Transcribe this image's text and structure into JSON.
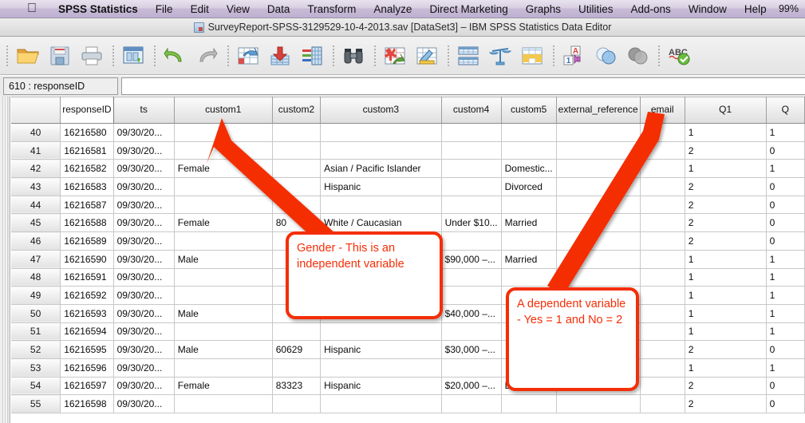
{
  "menubar": {
    "apple_icon": "apple-logo-icon",
    "items": [
      {
        "label": "SPSS Statistics",
        "bold": true
      },
      {
        "label": "File"
      },
      {
        "label": "Edit"
      },
      {
        "label": "View"
      },
      {
        "label": "Data"
      },
      {
        "label": "Transform"
      },
      {
        "label": "Analyze"
      },
      {
        "label": "Direct Marketing"
      },
      {
        "label": "Graphs"
      },
      {
        "label": "Utilities"
      },
      {
        "label": "Add-ons"
      },
      {
        "label": "Window"
      },
      {
        "label": "Help"
      }
    ],
    "battery_percent": "99%"
  },
  "titlebar": {
    "document_icon": "spss-document-icon",
    "title": "SurveyReport-SPSS-3129529-10-4-2013.sav [DataSet3] – IBM SPSS Statistics Data Editor"
  },
  "toolbar": {
    "buttons": [
      {
        "name": "open-file-icon",
        "glyph": "folder"
      },
      {
        "name": "save-file-icon",
        "glyph": "floppy"
      },
      {
        "name": "print-icon",
        "glyph": "printer"
      },
      {
        "name": "recall-dialogs-icon",
        "glyph": "window"
      },
      {
        "name": "undo-icon",
        "glyph": "undo"
      },
      {
        "name": "redo-icon",
        "glyph": "redo"
      },
      {
        "name": "goto-case-icon",
        "glyph": "goto-case"
      },
      {
        "name": "goto-variable-icon",
        "glyph": "goto-variable"
      },
      {
        "name": "variables-icon",
        "glyph": "variables"
      },
      {
        "name": "find-icon",
        "glyph": "binoculars"
      },
      {
        "name": "insert-case-icon",
        "glyph": "insert-case"
      },
      {
        "name": "insert-variable-icon",
        "glyph": "insert-variable"
      },
      {
        "name": "split-file-icon",
        "glyph": "split-file"
      },
      {
        "name": "weight-cases-icon",
        "glyph": "scales"
      },
      {
        "name": "select-cases-icon",
        "glyph": "select-cases"
      },
      {
        "name": "value-labels-icon",
        "glyph": "value-labels"
      },
      {
        "name": "use-variable-sets-icon",
        "glyph": "venn-blue"
      },
      {
        "name": "show-all-variables-icon",
        "glyph": "venn-gray"
      },
      {
        "name": "spell-check-icon",
        "glyph": "abc-check"
      }
    ]
  },
  "cell_reference": {
    "cell": "610 : responseID",
    "value": ""
  },
  "grid": {
    "columns": [
      {
        "key": "rownum",
        "label": "",
        "class": "c-rownum",
        "active": false
      },
      {
        "key": "responseID",
        "label": "responseID",
        "class": "c-responseID",
        "active": true
      },
      {
        "key": "ts",
        "label": "ts",
        "class": "c-ts",
        "active": false
      },
      {
        "key": "custom1",
        "label": "custom1",
        "class": "c-custom1",
        "active": false
      },
      {
        "key": "custom2",
        "label": "custom2",
        "class": "c-custom2",
        "active": false
      },
      {
        "key": "custom3",
        "label": "custom3",
        "class": "c-custom3",
        "active": false
      },
      {
        "key": "custom4",
        "label": "custom4",
        "class": "c-custom4",
        "active": false
      },
      {
        "key": "custom5",
        "label": "custom5",
        "class": "c-custom5",
        "active": false
      },
      {
        "key": "external",
        "label": "external_reference",
        "class": "c-external",
        "active": false
      },
      {
        "key": "email",
        "label": "email",
        "class": "c-email",
        "active": false
      },
      {
        "key": "Q1",
        "label": "Q1",
        "class": "c-Q1",
        "active": false
      },
      {
        "key": "Q2",
        "label": "Q",
        "class": "c-Q2",
        "active": false
      }
    ],
    "rows": [
      {
        "rownum": "40",
        "responseID": "16216580",
        "ts": "09/30/20...",
        "custom1": "",
        "custom2": "",
        "custom3": "",
        "custom4": "",
        "custom5": "",
        "external": "",
        "email": "",
        "Q1": "1",
        "Q2": "1"
      },
      {
        "rownum": "41",
        "responseID": "16216581",
        "ts": "09/30/20...",
        "custom1": "",
        "custom2": "",
        "custom3": "",
        "custom4": "",
        "custom5": "",
        "external": "",
        "email": "",
        "Q1": "2",
        "Q2": "0"
      },
      {
        "rownum": "42",
        "responseID": "16216582",
        "ts": "09/30/20...",
        "custom1": "Female",
        "custom2": "",
        "custom3": "Asian / Pacific Islander",
        "custom4": "",
        "custom5": "Domestic...",
        "external": "",
        "email": "",
        "Q1": "1",
        "Q2": "1"
      },
      {
        "rownum": "43",
        "responseID": "16216583",
        "ts": "09/30/20...",
        "custom1": "",
        "custom2": "",
        "custom3": "Hispanic",
        "custom4": "",
        "custom5": "Divorced",
        "external": "",
        "email": "",
        "Q1": "2",
        "Q2": "0"
      },
      {
        "rownum": "44",
        "responseID": "16216587",
        "ts": "09/30/20...",
        "custom1": "",
        "custom2": "",
        "custom3": "",
        "custom4": "",
        "custom5": "",
        "external": "",
        "email": "",
        "Q1": "2",
        "Q2": "0"
      },
      {
        "rownum": "45",
        "responseID": "16216588",
        "ts": "09/30/20...",
        "custom1": "Female",
        "custom2": "80",
        "custom3": "White / Caucasian",
        "custom4": "Under $10...",
        "custom5": "Married",
        "external": "",
        "email": "",
        "Q1": "2",
        "Q2": "0"
      },
      {
        "rownum": "46",
        "responseID": "16216589",
        "ts": "09/30/20...",
        "custom1": "",
        "custom2": "",
        "custom3": "",
        "custom4": "",
        "custom5": "",
        "external": "",
        "email": "",
        "Q1": "2",
        "Q2": "0"
      },
      {
        "rownum": "47",
        "responseID": "16216590",
        "ts": "09/30/20...",
        "custom1": "Male",
        "custom2": "",
        "custom3": "",
        "custom4": "$90,000 –...",
        "custom5": "Married",
        "external": "",
        "email": "",
        "Q1": "1",
        "Q2": "1"
      },
      {
        "rownum": "48",
        "responseID": "16216591",
        "ts": "09/30/20...",
        "custom1": "",
        "custom2": "",
        "custom3": "",
        "custom4": "",
        "custom5": "",
        "external": "",
        "email": "",
        "Q1": "1",
        "Q2": "1"
      },
      {
        "rownum": "49",
        "responseID": "16216592",
        "ts": "09/30/20...",
        "custom1": "",
        "custom2": "",
        "custom3": "",
        "custom4": "",
        "custom5": "",
        "external": "",
        "email": "",
        "Q1": "1",
        "Q2": "1"
      },
      {
        "rownum": "50",
        "responseID": "16216593",
        "ts": "09/30/20...",
        "custom1": "Male",
        "custom2": "",
        "custom3": "",
        "custom4": "$40,000 –...",
        "custom5": "",
        "external": "",
        "email": "",
        "Q1": "1",
        "Q2": "1"
      },
      {
        "rownum": "51",
        "responseID": "16216594",
        "ts": "09/30/20...",
        "custom1": "",
        "custom2": "",
        "custom3": "",
        "custom4": "",
        "custom5": "",
        "external": "",
        "email": "",
        "Q1": "1",
        "Q2": "1"
      },
      {
        "rownum": "52",
        "responseID": "16216595",
        "ts": "09/30/20...",
        "custom1": "Male",
        "custom2": "60629",
        "custom3": "Hispanic",
        "custom4": "$30,000 –...",
        "custom5": "",
        "external": "",
        "email": "",
        "Q1": "2",
        "Q2": "0"
      },
      {
        "rownum": "53",
        "responseID": "16216596",
        "ts": "09/30/20...",
        "custom1": "",
        "custom2": "",
        "custom3": "",
        "custom4": "",
        "custom5": "",
        "external": "",
        "email": "",
        "Q1": "1",
        "Q2": "1"
      },
      {
        "rownum": "54",
        "responseID": "16216597",
        "ts": "09/30/20...",
        "custom1": "Female",
        "custom2": "83323",
        "custom3": "Hispanic",
        "custom4": "$20,000 –...",
        "custom5": "Domestic...",
        "external": "",
        "email": "",
        "Q1": "2",
        "Q2": "0"
      },
      {
        "rownum": "55",
        "responseID": "16216598",
        "ts": "09/30/20...",
        "custom1": "",
        "custom2": "",
        "custom3": "",
        "custom4": "",
        "custom5": "",
        "external": "",
        "email": "",
        "Q1": "2",
        "Q2": "0"
      }
    ]
  },
  "annotations": {
    "accent_color": "#f42e06",
    "callouts": [
      {
        "id": "gender",
        "text": "Gender - This is an independent variable"
      },
      {
        "id": "dependent",
        "text": "A dependent variable - Yes = 1 and No = 2"
      }
    ]
  }
}
